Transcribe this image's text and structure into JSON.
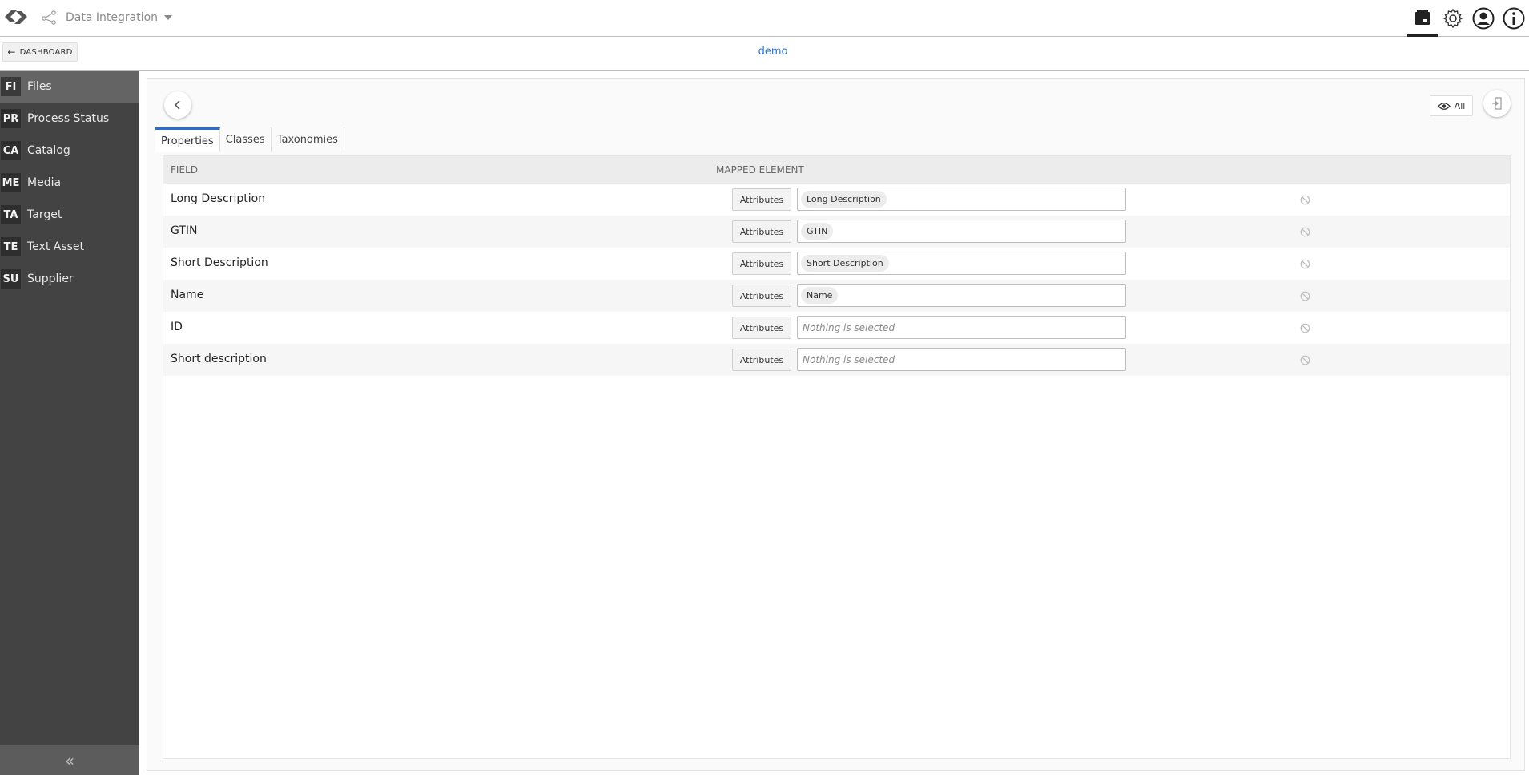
{
  "header": {
    "app_name": "Data Integration"
  },
  "subheader": {
    "dashboard_label": "DASHBOARD",
    "context_title": "demo"
  },
  "sidebar": {
    "items": [
      {
        "badge": "FI",
        "label": "Files",
        "active": true
      },
      {
        "badge": "PR",
        "label": "Process Status",
        "active": false
      },
      {
        "badge": "CA",
        "label": "Catalog",
        "active": false
      },
      {
        "badge": "ME",
        "label": "Media",
        "active": false
      },
      {
        "badge": "TA",
        "label": "Target",
        "active": false
      },
      {
        "badge": "TE",
        "label": "Text Asset",
        "active": false
      },
      {
        "badge": "SU",
        "label": "Supplier",
        "active": false
      }
    ],
    "collapse_glyph": "«"
  },
  "toolbar": {
    "filter_label": "All"
  },
  "tabs": [
    {
      "label": "Properties",
      "active": true
    },
    {
      "label": "Classes",
      "active": false
    },
    {
      "label": "Taxonomies",
      "active": false
    }
  ],
  "table": {
    "headers": {
      "field": "FIELD",
      "mapped": "MAPPED ELEMENT"
    },
    "rows": [
      {
        "field": "Long Description",
        "source": "Attributes",
        "value": "Long Description",
        "placeholder": ""
      },
      {
        "field": "GTIN",
        "source": "Attributes",
        "value": "GTIN",
        "placeholder": ""
      },
      {
        "field": "Short Description",
        "source": "Attributes",
        "value": "Short Description",
        "placeholder": ""
      },
      {
        "field": "Name",
        "source": "Attributes",
        "value": "Name",
        "placeholder": ""
      },
      {
        "field": "ID",
        "source": "Attributes",
        "value": "",
        "placeholder": "Nothing is selected"
      },
      {
        "field": "Short description",
        "source": "Attributes",
        "value": "",
        "placeholder": "Nothing is selected"
      }
    ]
  },
  "colors": {
    "accent": "#2a6fcf",
    "sidebar_bg": "#434343",
    "sidebar_active": "#646464"
  }
}
